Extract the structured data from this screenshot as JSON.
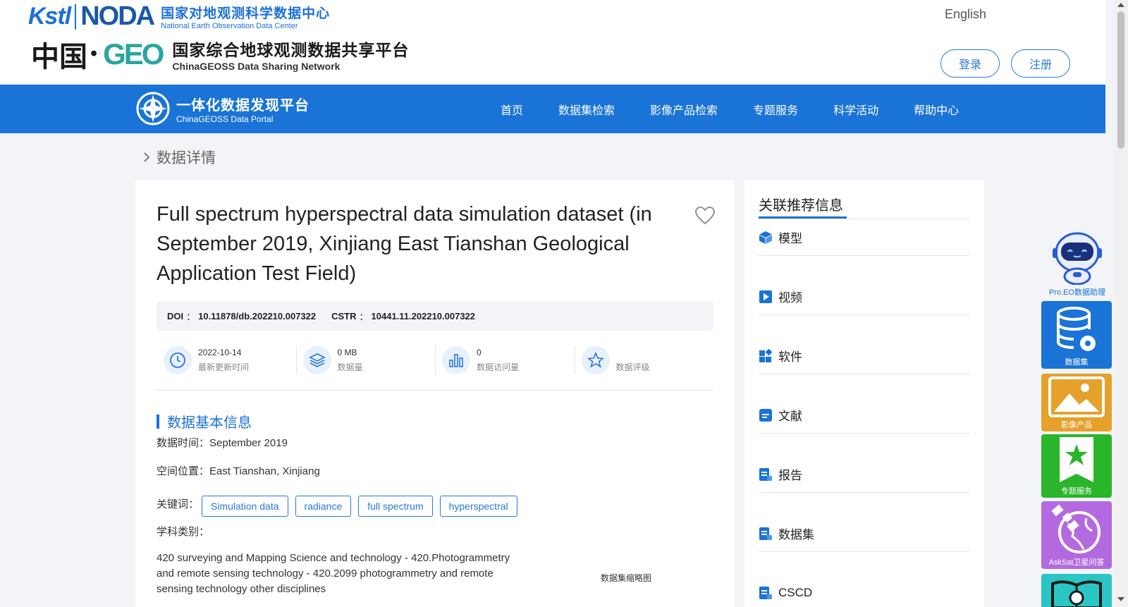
{
  "header": {
    "logo1": {
      "kstl": "Kstl",
      "noda": "NODA",
      "cn": "国家对地观测科学数据中心",
      "en": "National Earth Observation Data Center"
    },
    "logo2": {
      "china": "中国",
      "geo": "GEO",
      "cn": "国家综合地球观测数据共享平台",
      "en": "ChinaGEOSS Data Sharing Network"
    },
    "language": "English",
    "login": "登录",
    "register": "注册"
  },
  "nav": {
    "portal_cn": "一体化数据发现平台",
    "portal_en": "ChinaGEOSS Data Portal",
    "items": [
      "首页",
      "数据集检索",
      "影像产品检索",
      "专题服务",
      "科学活动",
      "帮助中心"
    ]
  },
  "breadcrumb": "数据详情",
  "dataset": {
    "title": "Full spectrum hyperspectral data simulation dataset (in September 2019, Xinjiang East Tianshan Geological Application Test Field)",
    "doi_label": "DOI",
    "doi": "10.11878/db.202210.007322",
    "cstr_label": "CSTR",
    "cstr": "10441.11.202210.007322",
    "sep": "：",
    "stats": [
      {
        "value": "2022-10-14",
        "label": "最新更新时间"
      },
      {
        "value": "0 MB",
        "label": "数据量"
      },
      {
        "value": "0",
        "label": "数据访问量"
      },
      {
        "value": "",
        "label": "数据评级"
      }
    ],
    "section_title": "数据基本信息",
    "time_label": "数据时间：",
    "time_value": "September 2019",
    "location_label": "空间位置：",
    "location_value": "East Tianshan, Xinjiang",
    "keywords_label": "关键词：",
    "keywords": [
      "Simulation data",
      "radiance",
      "full spectrum",
      "hyperspectral"
    ],
    "subject_label": "学科类别：",
    "subject_value": "420 surveying and Mapping Science and technology - 420.Photogrammetry and remote sensing technology - 420.2099 photogrammetry and remote sensing technology other disciplines",
    "thumbnail_label": "数据集缩略图"
  },
  "side": {
    "title": "关联推荐信息",
    "items": [
      "模型",
      "视频",
      "软件",
      "文献",
      "报告",
      "数据集",
      "CSCD"
    ]
  },
  "widgets": {
    "assistant": "Pro.EO数据助理",
    "dataset": "数据集",
    "image": "影像产品",
    "special": "专题服务",
    "asksat": "AskSat卫星问答"
  },
  "colors": {
    "primary": "#1a73d6",
    "image": "#e5a12a",
    "special": "#2ab52a",
    "asksat": "#b36ae0",
    "book": "#2ac6c6"
  }
}
